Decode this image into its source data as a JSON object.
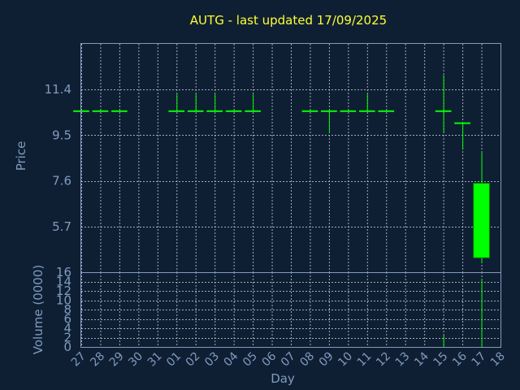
{
  "chart_data": {
    "type": "candlestick",
    "title": "AUTG - last updated 17/09/2025",
    "xlabel": "Day",
    "ylabel": "Price",
    "volume_label": "Volume (0000)",
    "x_ticks": [
      "27",
      "28",
      "29",
      "30",
      "31",
      "01",
      "02",
      "03",
      "04",
      "05",
      "06",
      "07",
      "08",
      "09",
      "10",
      "11",
      "12",
      "13",
      "14",
      "15",
      "16",
      "17",
      "18"
    ],
    "price_ticks": [
      5.7,
      7.6,
      9.5,
      11.4
    ],
    "price_range": [
      3.8,
      13.3
    ],
    "volume_ticks": [
      0,
      2,
      4,
      6,
      8,
      10,
      12,
      14,
      16
    ],
    "volume_range": [
      0,
      16
    ],
    "grid": true,
    "up_color": "#00ff00",
    "line_color": "#00ff00",
    "candles": [
      {
        "day": "27",
        "open": 10.5,
        "high": 10.5,
        "low": 10.5,
        "close": 10.5,
        "volume": 0
      },
      {
        "day": "28",
        "open": 10.5,
        "high": 10.5,
        "low": 10.5,
        "close": 10.5,
        "volume": 0
      },
      {
        "day": "29",
        "open": 10.5,
        "high": 10.5,
        "low": 10.5,
        "close": 10.5,
        "volume": 0
      },
      {
        "day": "01",
        "open": 10.5,
        "high": 11.2,
        "low": 10.5,
        "close": 10.5,
        "volume": 0
      },
      {
        "day": "02",
        "open": 10.5,
        "high": 11.2,
        "low": 10.5,
        "close": 10.5,
        "volume": 0
      },
      {
        "day": "03",
        "open": 10.5,
        "high": 11.2,
        "low": 10.5,
        "close": 10.5,
        "volume": 0
      },
      {
        "day": "04",
        "open": 10.5,
        "high": 10.5,
        "low": 10.5,
        "close": 10.5,
        "volume": 0
      },
      {
        "day": "05",
        "open": 10.5,
        "high": 11.2,
        "low": 10.5,
        "close": 10.5,
        "volume": 0
      },
      {
        "day": "08",
        "open": 10.5,
        "high": 10.5,
        "low": 10.5,
        "close": 10.5,
        "volume": 0
      },
      {
        "day": "09",
        "open": 10.5,
        "high": 10.5,
        "low": 9.6,
        "close": 10.5,
        "volume": 0
      },
      {
        "day": "10",
        "open": 10.5,
        "high": 10.5,
        "low": 10.5,
        "close": 10.5,
        "volume": 0
      },
      {
        "day": "11",
        "open": 10.5,
        "high": 11.2,
        "low": 10.5,
        "close": 10.5,
        "volume": 0
      },
      {
        "day": "12",
        "open": 10.5,
        "high": 10.5,
        "low": 10.5,
        "close": 10.5,
        "volume": 0
      },
      {
        "day": "15",
        "open": 10.5,
        "high": 12.0,
        "low": 9.6,
        "close": 10.5,
        "volume": 2.6
      },
      {
        "day": "16",
        "open": 10.0,
        "high": 10.0,
        "low": 8.9,
        "close": 10.0,
        "volume": 0
      },
      {
        "day": "17",
        "open": 4.4,
        "high": 8.8,
        "low": 4.2,
        "close": 7.5,
        "volume": 14.5
      }
    ]
  }
}
